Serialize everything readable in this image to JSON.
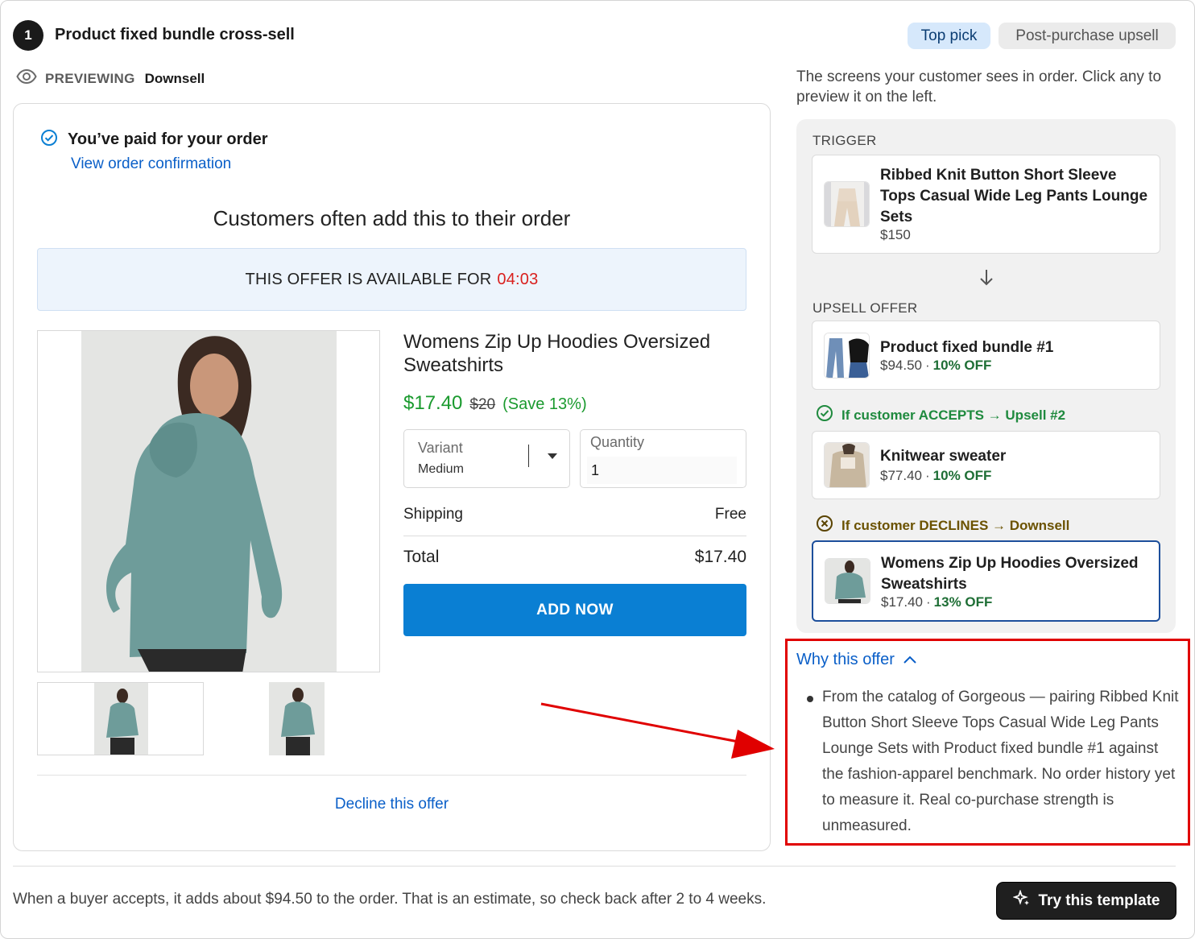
{
  "header": {
    "step_number": "1",
    "title": "Product fixed bundle cross-sell",
    "badges": [
      "Top pick",
      "Post-purchase upsell"
    ]
  },
  "previewing": {
    "label": "PREVIEWING",
    "value": "Downsell"
  },
  "preview": {
    "paid_title": "You’ve paid for your order",
    "view_confirmation": "View order confirmation",
    "heading": "Customers often add this to their order",
    "offer_banner": "THIS OFFER IS AVAILABLE FOR",
    "timer": "04:03",
    "product_title": "Womens Zip Up Hoodies Oversized Sweatshirts",
    "price_now": "$17.40",
    "price_was": "$20",
    "price_save": "(Save 13%)",
    "variant_label": "Variant",
    "variant_value": "Medium",
    "quantity_label": "Quantity",
    "quantity_value": "1",
    "shipping_label": "Shipping",
    "shipping_value": "Free",
    "total_label": "Total",
    "total_value": "$17.40",
    "add_button": "ADD NOW",
    "decline_link": "Decline this offer"
  },
  "flow": {
    "description": "The screens your customer sees in order. Click any to preview it on the left.",
    "trigger_label": "TRIGGER",
    "trigger": {
      "title": "Ribbed Knit Button Short Sleeve Tops Casual Wide Leg Pants Lounge Sets",
      "price": "$150"
    },
    "upsell_label": "UPSELL OFFER",
    "upsell": {
      "title": "Product fixed bundle #1",
      "price": "$94.50",
      "discount": "10% OFF"
    },
    "accept_condition": "If customer ACCEPTS → Upsell #2",
    "upsell2": {
      "title": "Knitwear sweater",
      "price": "$77.40",
      "discount": "10% OFF"
    },
    "decline_condition": "If customer DECLINES → Downsell",
    "downsell": {
      "title": "Womens Zip Up Hoodies Oversized Sweatshirts",
      "price": "$17.40",
      "discount": "13% OFF"
    },
    "separator": "·"
  },
  "why": {
    "toggle": "Why this offer",
    "text": "From the catalog of Gorgeous — pairing Ribbed Knit Button Short Sleeve Tops Casual Wide Leg Pants Lounge Sets with Product fixed bundle #1 against the fashion-apparel benchmark. No order history yet to measure it. Real co-purchase strength is unmeasured."
  },
  "footer": {
    "text": "When a buyer accepts, it adds about $94.50 to the order. That is an estimate, so check back after 2 to 4 weeks.",
    "button": "Try this template"
  },
  "colors": {
    "accent_blue": "#0a7fd3",
    "link_blue": "#0a5fc8",
    "green": "#1a9a2e",
    "timer_red": "#d9201e",
    "highlight_red": "#e00000"
  }
}
